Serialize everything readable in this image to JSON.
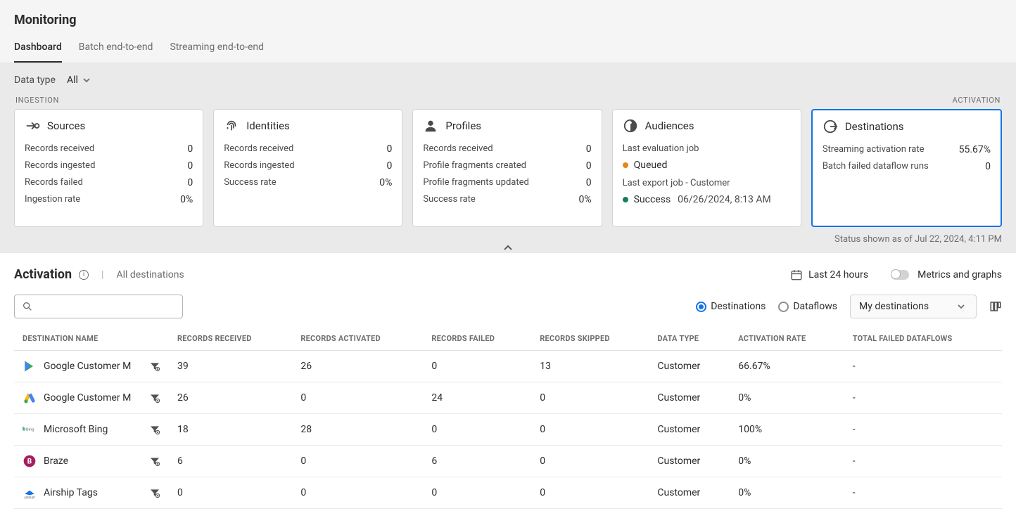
{
  "page": {
    "title": "Monitoring"
  },
  "tabs": [
    {
      "label": "Dashboard",
      "active": true
    },
    {
      "label": "Batch end-to-end",
      "active": false
    },
    {
      "label": "Streaming end-to-end",
      "active": false
    }
  ],
  "filter": {
    "label": "Data type",
    "value": "All"
  },
  "section_labels": {
    "ingestion": "INGESTION",
    "activation": "ACTIVATION"
  },
  "cards": {
    "sources": {
      "title": "Sources",
      "records_received_label": "Records received",
      "records_received": "0",
      "records_ingested_label": "Records ingested",
      "records_ingested": "0",
      "records_failed_label": "Records failed",
      "records_failed": "0",
      "ingestion_rate_label": "Ingestion rate",
      "ingestion_rate": "0%"
    },
    "identities": {
      "title": "Identities",
      "records_received_label": "Records received",
      "records_received": "0",
      "records_ingested_label": "Records ingested",
      "records_ingested": "0",
      "success_rate_label": "Success rate",
      "success_rate": "0%"
    },
    "profiles": {
      "title": "Profiles",
      "records_received_label": "Records received",
      "records_received": "0",
      "fragments_created_label": "Profile fragments created",
      "fragments_created": "0",
      "fragments_updated_label": "Profile fragments updated",
      "fragments_updated": "0",
      "success_rate_label": "Success rate",
      "success_rate": "0%"
    },
    "audiences": {
      "title": "Audiences",
      "last_eval_label": "Last evaluation job",
      "queued_label": "Queued",
      "last_export_label": "Last export job - Customer",
      "success_label": "Success",
      "success_ts": "06/26/2024, 8:13 AM"
    },
    "destinations": {
      "title": "Destinations",
      "streaming_rate_label": "Streaming activation rate",
      "streaming_rate": "55.67%",
      "batch_failed_label": "Batch failed dataflow runs",
      "batch_failed": "0"
    }
  },
  "status_line": "Status shown as of Jul 22, 2024, 4:11 PM",
  "activation": {
    "title": "Activation",
    "all_destinations": "All destinations",
    "time_range": "Last 24 hours",
    "metrics_toggle_label": "Metrics and graphs",
    "radio_destinations": "Destinations",
    "radio_dataflows": "Dataflows",
    "dropdown_value": "My destinations"
  },
  "table": {
    "headers": {
      "name": "DESTINATION NAME",
      "received": "RECORDS RECEIVED",
      "activated": "RECORDS ACTIVATED",
      "failed": "RECORDS FAILED",
      "skipped": "RECORDS SKIPPED",
      "data_type": "DATA TYPE",
      "rate": "ACTIVATION RATE",
      "total_failed": "TOTAL FAILED DATAFLOWS"
    },
    "rows": [
      {
        "name": "Google Customer M",
        "received": "39",
        "activated": "26",
        "failed": "0",
        "skipped": "13",
        "data_type": "Customer",
        "rate": "66.67%",
        "total_failed": "-",
        "icon": "google-play"
      },
      {
        "name": "Google Customer M",
        "received": "26",
        "activated": "0",
        "failed": "24",
        "skipped": "0",
        "data_type": "Customer",
        "rate": "0%",
        "total_failed": "-",
        "icon": "google-ads"
      },
      {
        "name": "Microsoft Bing",
        "received": "18",
        "activated": "28",
        "failed": "0",
        "skipped": "0",
        "data_type": "Customer",
        "rate": "100%",
        "total_failed": "-",
        "icon": "bing"
      },
      {
        "name": "Braze",
        "received": "6",
        "activated": "0",
        "failed": "6",
        "skipped": "0",
        "data_type": "Customer",
        "rate": "0%",
        "total_failed": "-",
        "icon": "braze"
      },
      {
        "name": "Airship Tags",
        "received": "0",
        "activated": "0",
        "failed": "0",
        "skipped": "0",
        "data_type": "Customer",
        "rate": "0%",
        "total_failed": "-",
        "icon": "airship"
      }
    ]
  }
}
